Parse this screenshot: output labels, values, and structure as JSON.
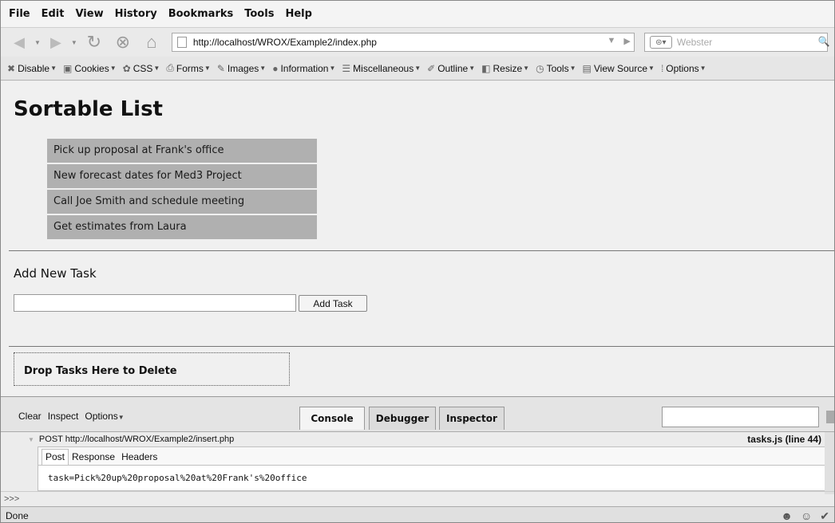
{
  "menu": [
    "File",
    "Edit",
    "View",
    "History",
    "Bookmarks",
    "Tools",
    "Help"
  ],
  "nav": {
    "url": "http://localhost/WROX/Example2/index.php",
    "search_placeholder": "Webster"
  },
  "devtools": [
    "Disable",
    "Cookies",
    "CSS",
    "Forms",
    "Images",
    "Information",
    "Miscellaneous",
    "Outline",
    "Resize",
    "Tools",
    "View Source",
    "Options"
  ],
  "page": {
    "title": "Sortable List",
    "tasks": [
      "Pick up proposal at Frank's office",
      "New forecast dates for Med3 Project",
      "Call Joe Smith and schedule meeting",
      "Get estimates from Laura"
    ],
    "add_heading": "Add New Task",
    "add_button": "Add Task",
    "drop_zone": "Drop Tasks Here to Delete"
  },
  "firebug": {
    "left": [
      "Clear",
      "Inspect",
      "Options"
    ],
    "tabs": [
      "Console",
      "Debugger",
      "Inspector"
    ],
    "log_request": "POST http://localhost/WROX/Example2/insert.php",
    "log_source": "tasks.js (line 44)",
    "panel_tabs": [
      "Post",
      "Response",
      "Headers"
    ],
    "post_body": "task=Pick%20up%20proposal%20at%20Frank's%20office",
    "prompt": ">>>"
  },
  "status": "Done"
}
